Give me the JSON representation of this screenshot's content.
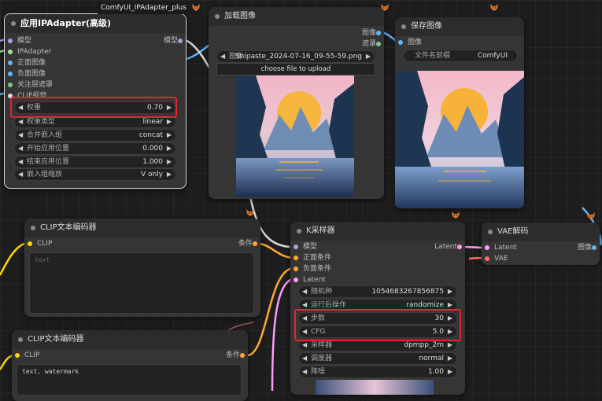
{
  "group_label": "ComfyUI_IPAdapter_plus",
  "colors": {
    "model": "#b39ddb",
    "ipadapter": "#9fe6a0",
    "image": "#64b5f6",
    "mask": "#81c784",
    "clip": "#ffd500",
    "conditioning": "#ffa931",
    "conditioning_neg": "#ff7f7f",
    "latent": "#ff9cf9",
    "vae": "#ff6e6e",
    "highlight": "#e0262f"
  },
  "ipadapter_node": {
    "title": "应用IPAdapter(高级)",
    "inputs": [
      "模型",
      "IPAdapter",
      "正面图像",
      "负面图像",
      "关注层遮罩",
      "CLIP视觉"
    ],
    "output": "模型",
    "widgets": [
      {
        "label": "权重",
        "value": "0.70"
      },
      {
        "label": "权重类型",
        "value": "linear"
      },
      {
        "label": "合并嵌入组",
        "value": "concat"
      },
      {
        "label": "开始应用位置",
        "value": "0.000"
      },
      {
        "label": "结束应用位置",
        "value": "1.000"
      },
      {
        "label": "嵌入组缩放",
        "value": "V only"
      }
    ]
  },
  "load_image_node": {
    "title": "加载图像",
    "outputs": [
      "图像",
      "遮罩"
    ],
    "image_widget": {
      "label": "图像",
      "value": "Snipaste_2024-07-16_09-55-59.png"
    },
    "upload_label": "choose file to upload"
  },
  "save_image_node": {
    "title": "保存图像",
    "input": "图像",
    "prefix_widget": {
      "label": "文件名前缀",
      "value": "ComfyUI"
    }
  },
  "clip_encoder_1": {
    "title": "CLIP文本编码器",
    "input": "CLIP",
    "output": "条件",
    "placeholder": "text"
  },
  "clip_encoder_2": {
    "title": "CLIP文本编码器",
    "input": "CLIP",
    "output": "条件",
    "text": "text, watermark"
  },
  "ksampler_node": {
    "title": "K采样器",
    "inputs": [
      "模型",
      "正面条件",
      "负面条件",
      "Latent"
    ],
    "output": "Latent",
    "widgets": [
      {
        "label": "随机种",
        "value": "1054683267856875"
      },
      {
        "label": "运行后操作",
        "value": "randomize"
      },
      {
        "label": "步数",
        "value": "30"
      },
      {
        "label": "CFG",
        "value": "5.0"
      },
      {
        "label": "采样器",
        "value": "dpmpp_2m"
      },
      {
        "label": "调度器",
        "value": "normal"
      },
      {
        "label": "降噪",
        "value": "1.00"
      }
    ]
  },
  "vae_decode_node": {
    "title": "VAE解码",
    "inputs": [
      "Latent",
      "VAE"
    ],
    "output": "图像"
  },
  "icons": {
    "node_badge": "fox-badge-icon",
    "widget_left": "arrow-left-icon",
    "widget_right": "arrow-right-icon"
  }
}
